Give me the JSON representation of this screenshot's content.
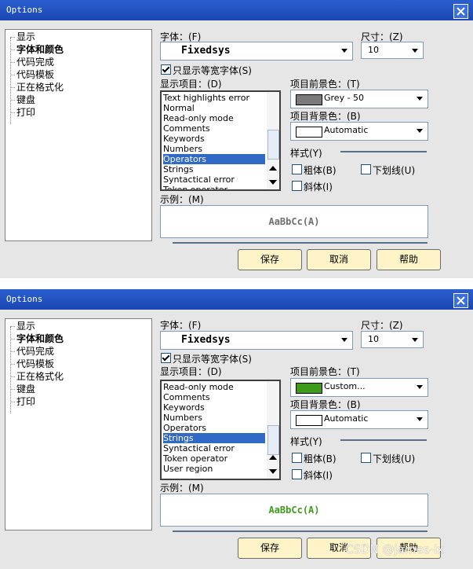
{
  "dialogs": [
    {
      "title": "Options",
      "tree": [
        "显示",
        "字体和颜色",
        "代码完成",
        "代码模板",
        "正在格式化",
        "键盘",
        "打印"
      ],
      "font_label": "字体：(F)",
      "font_value": "Fixedsys",
      "size_label": "尺寸：(Z)",
      "size_value": "10",
      "mono_label": "只显示等宽字体(S)",
      "display_items_label": "显示项目：(D)",
      "display_items": [
        "Text highlights error",
        "Normal",
        "Read-only mode",
        "Comments",
        "Keywords",
        "Numbers",
        "Operators",
        "Strings",
        "Syntactical error",
        "Token operator"
      ],
      "selected_item": "Operators",
      "fg_label": "项目前景色：(T)",
      "fg_value": "Grey - 50",
      "fg_color": "#7a7a7a",
      "bg_label": "项目背景色：(B)",
      "bg_value": "Automatic",
      "bg_color": "#ffffff",
      "style_label": "样式(Y)",
      "bold_label": "粗体(B)",
      "underline_label": "下划线(U)",
      "italic_label": "斜体(I)",
      "sample_label": "示例：(M)",
      "sample_text": "AaBbCc(A)",
      "sample_color": "#6e6e6e",
      "save_label": "保存",
      "cancel_label": "取消",
      "help_label": "帮助"
    },
    {
      "title": "Options",
      "tree": [
        "显示",
        "字体和颜色",
        "代码完成",
        "代码模板",
        "正在格式化",
        "键盘",
        "打印"
      ],
      "font_label": "字体：(F)",
      "font_value": "Fixedsys",
      "size_label": "尺寸：(Z)",
      "size_value": "10",
      "mono_label": "只显示等宽字体(S)",
      "display_items_label": "显示项目：(D)",
      "display_items": [
        "Read-only mode",
        "Comments",
        "Keywords",
        "Numbers",
        "Operators",
        "Strings",
        "Syntactical error",
        "Token operator",
        "User region"
      ],
      "selected_item": "Strings",
      "fg_label": "项目前景色：(T)",
      "fg_value": "Custom...",
      "fg_color": "#3f9a1c",
      "bg_label": "项目背景色：(B)",
      "bg_value": "Automatic",
      "bg_color": "#ffffff",
      "style_label": "样式(Y)",
      "bold_label": "粗体(B)",
      "underline_label": "下划线(U)",
      "italic_label": "斜体(I)",
      "sample_label": "示例：(M)",
      "sample_text": "AaBbCc(A)",
      "sample_color": "#3f9a1c",
      "save_label": "保存",
      "cancel_label": "取消",
      "help_label": "帮助"
    }
  ],
  "watermark": "CSDN @james-lx"
}
